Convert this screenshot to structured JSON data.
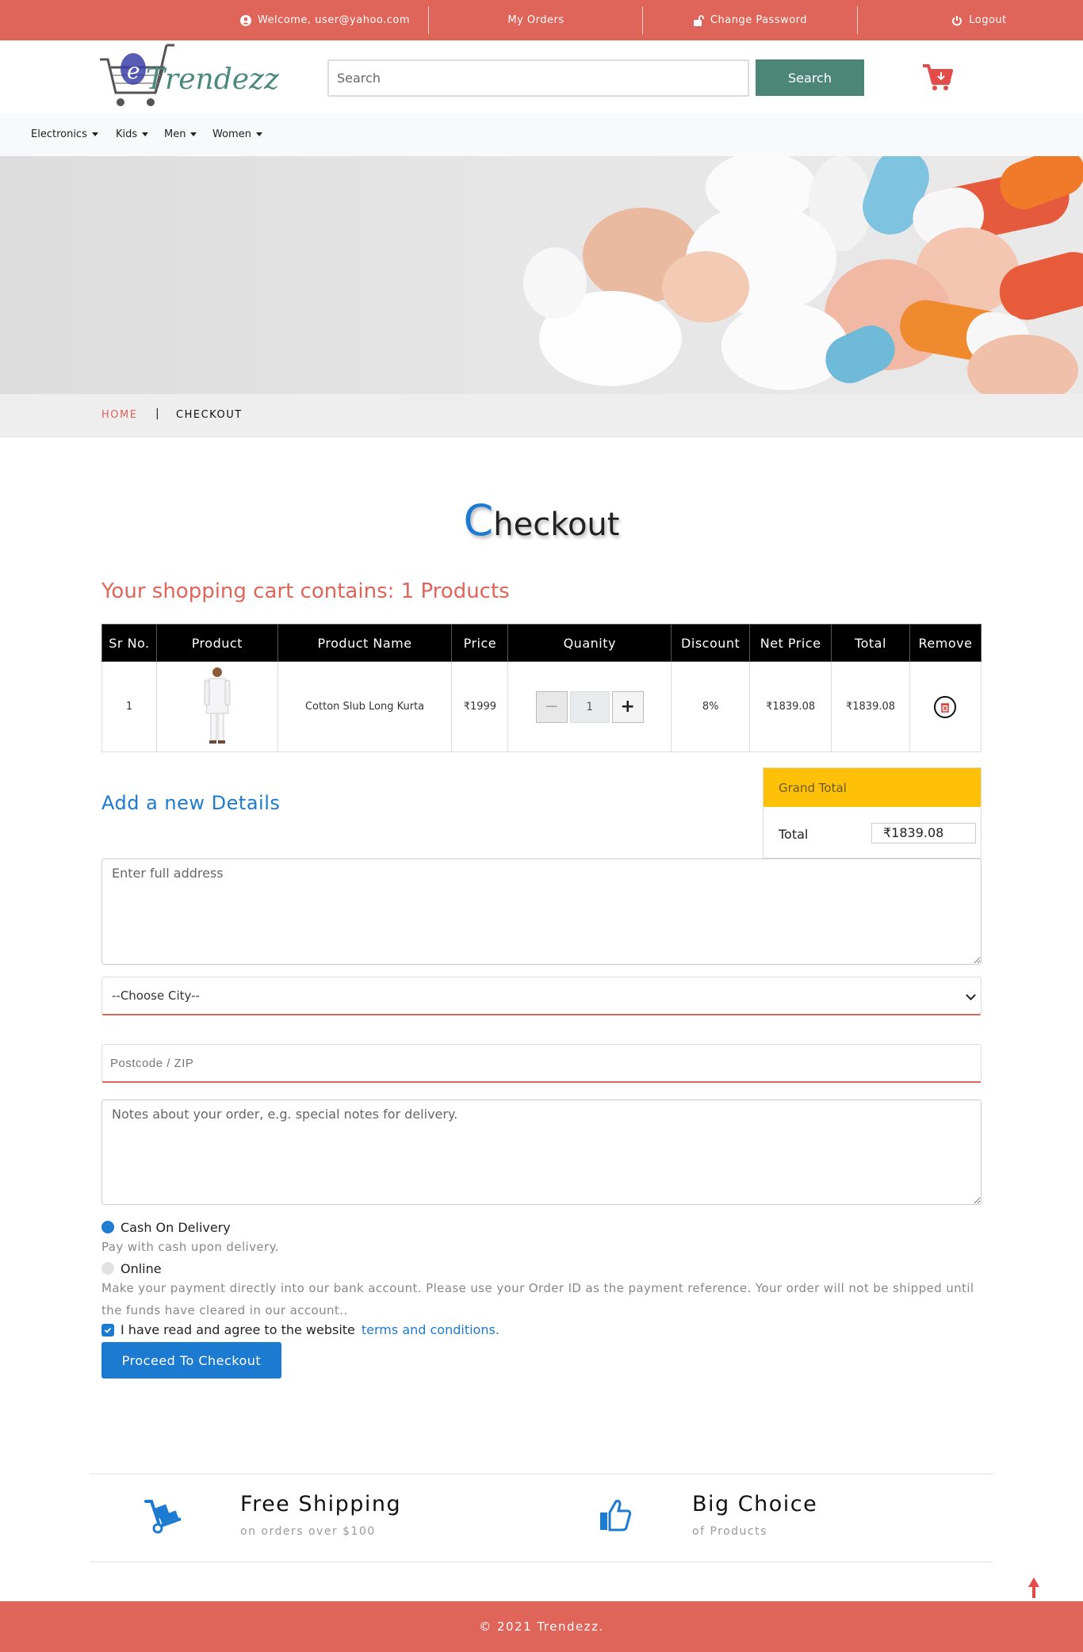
{
  "topbar": {
    "welcome": "Welcome, user@yahoo.com",
    "my_orders": "My Orders",
    "change_password": "Change Password",
    "logout": "Logout"
  },
  "header": {
    "logo_text": "Trendezz",
    "search_placeholder": "Search",
    "search_button": "Search"
  },
  "nav": {
    "items": [
      "Electronics",
      "Kids",
      "Men",
      "Women"
    ]
  },
  "breadcrumb": {
    "home": "HOME",
    "separator": "|",
    "current": "CHECKOUT"
  },
  "page": {
    "title_initial": "C",
    "title_rest": "heckout",
    "cart_count": "Your shopping cart contains: 1 Products"
  },
  "table": {
    "headers": [
      "Sr No.",
      "Product",
      "Product Name",
      "Price",
      "Quanity",
      "Discount",
      "Net Price",
      "Total",
      "Remove"
    ],
    "rows": [
      {
        "sr": "1",
        "name": "Cotton Slub Long Kurta",
        "price": "₹1999",
        "quantity": "1",
        "discount": "8%",
        "net_price": "₹1839.08",
        "total": "₹1839.08"
      }
    ]
  },
  "grand_total": {
    "header": "Grand Total",
    "label": "Total",
    "value": "₹1839.08"
  },
  "form": {
    "section_title": "Add a new Details",
    "address_placeholder": "Enter full address",
    "city_selected": "--Choose City--",
    "zip_placeholder": "Postcode / ZIP",
    "notes_placeholder": "Notes about your order, e.g. special notes for delivery.",
    "payment": {
      "cod_label": "Cash On Delivery",
      "cod_hint": "Pay with cash upon delivery.",
      "online_label": "Online",
      "online_hint": "Make your payment directly into our bank account. Please use your Order ID as the payment reference. Your order will not be shipped until the funds have cleared in our account.."
    },
    "agree_text": "I have read and agree to the website",
    "agree_link": "terms and conditions.",
    "proceed": "Proceed To Checkout"
  },
  "features": {
    "shipping_title": "Free Shipping",
    "shipping_sub": "on orders over $100",
    "choice_title": "Big Choice",
    "choice_sub": "of Products"
  },
  "footer": {
    "copyright": "© 2021 Trendezz."
  },
  "colors": {
    "brand": "#df6459",
    "accent": "#1c7bd0",
    "search_button": "#4c8677",
    "grand_total_header": "#ffc107"
  },
  "icons": [
    "user-icon",
    "lock-icon",
    "power-icon",
    "cart-icon",
    "caret-down-icon",
    "remove-icon",
    "minus-icon",
    "plus-icon",
    "dolly-icon",
    "thumbs-up-icon",
    "arrow-up-icon"
  ]
}
